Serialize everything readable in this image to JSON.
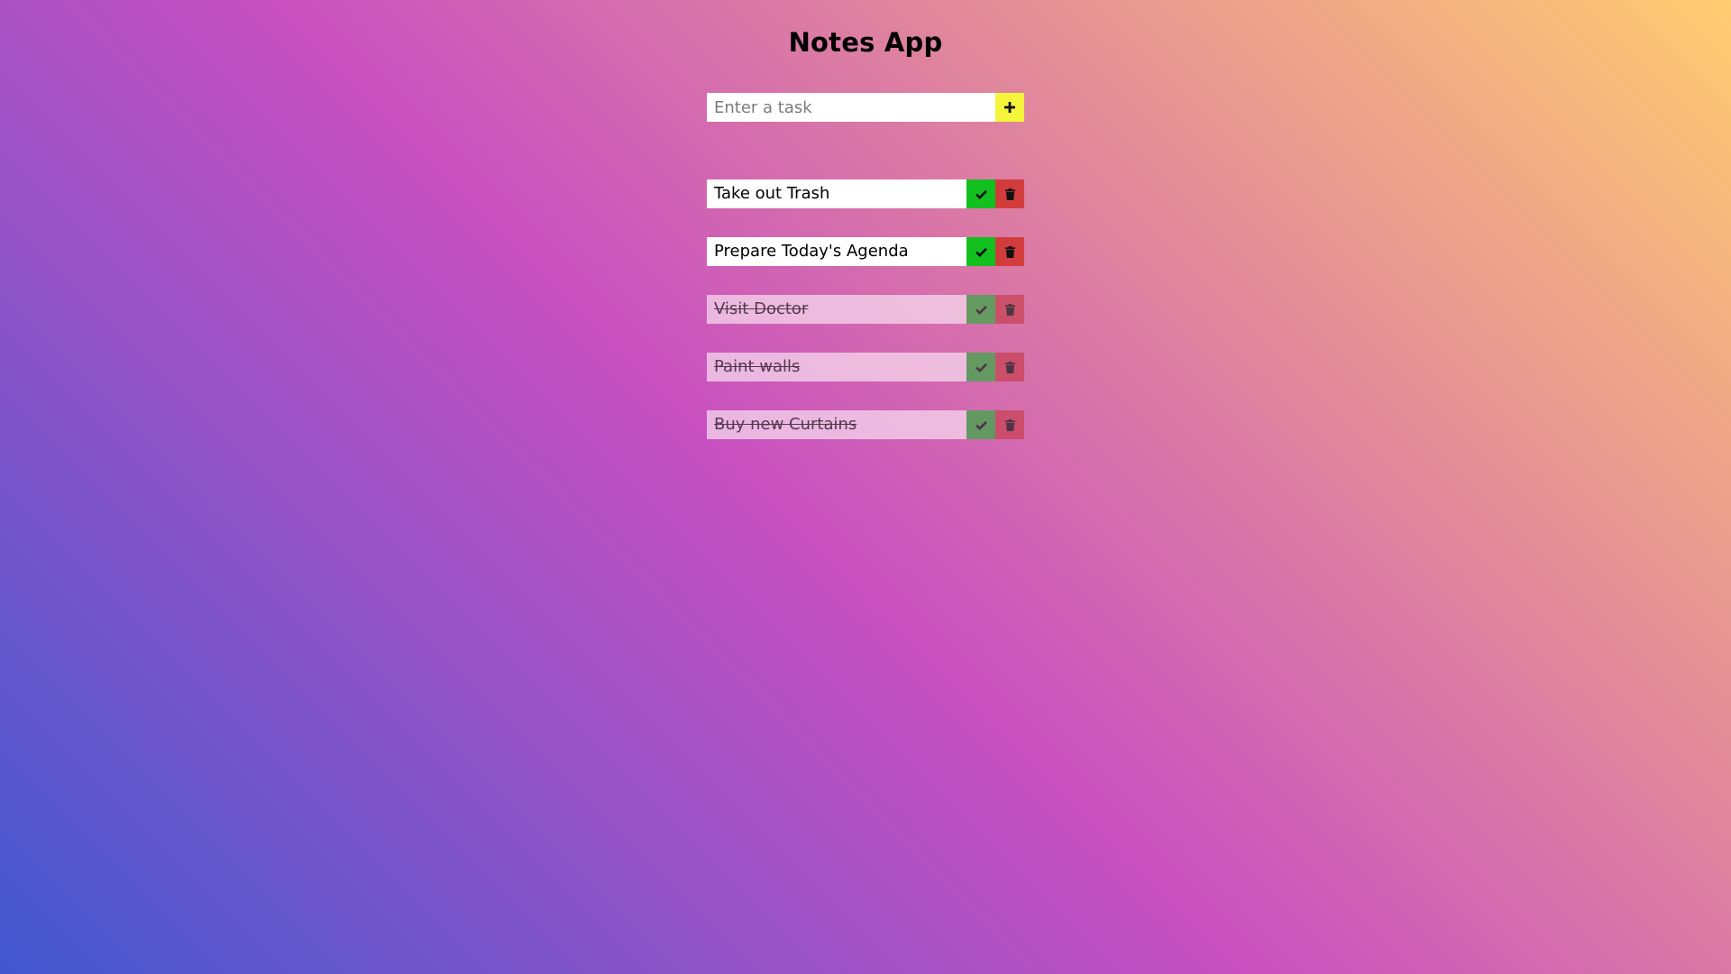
{
  "app": {
    "title": "Notes App"
  },
  "input": {
    "placeholder": "Enter a task",
    "value": ""
  },
  "icons": {
    "add": "plus-icon",
    "complete": "check-icon",
    "delete": "trash-icon"
  },
  "colors": {
    "add_button": "#f4f43a",
    "complete_button": "#12c01f",
    "delete_button": "#d23c3c"
  },
  "tasks": [
    {
      "label": "Take out Trash",
      "completed": false
    },
    {
      "label": "Prepare Today's Agenda",
      "completed": false
    },
    {
      "label": "Visit Doctor",
      "completed": true
    },
    {
      "label": "Paint walls",
      "completed": true
    },
    {
      "label": "Buy new Curtains",
      "completed": true
    }
  ]
}
